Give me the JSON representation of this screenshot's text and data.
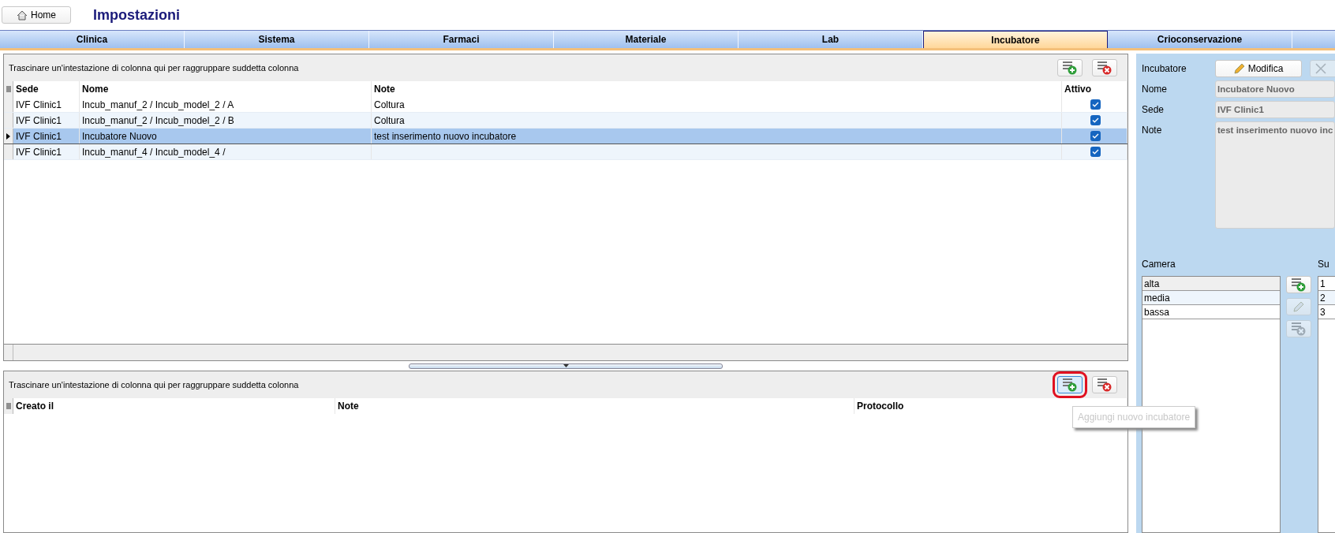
{
  "top_bar": {
    "home_button": "Home",
    "title": "Impostazioni"
  },
  "tabs": [
    {
      "label": "Clinica",
      "selected": false
    },
    {
      "label": "Sistema",
      "selected": false
    },
    {
      "label": "Farmaci",
      "selected": false
    },
    {
      "label": "Materiale",
      "selected": false
    },
    {
      "label": "Lab",
      "selected": false
    },
    {
      "label": "Incubatore",
      "selected": true
    },
    {
      "label": "Crioconservazione",
      "selected": false
    }
  ],
  "upper_grid": {
    "group_hint": "Trascinare un'intestazione di colonna qui per raggruppare suddetta colonna",
    "buttons": [
      {
        "kind": "add",
        "highlighted": false
      },
      {
        "kind": "delete",
        "highlighted": false
      }
    ],
    "columns": [
      "Sede",
      "Nome",
      "Note",
      "Attivo"
    ],
    "rows": [
      {
        "sede": "IVF Clinic1",
        "nome": "Incub_manuf_2 / Incub_model_2 / A",
        "note": "Coltura",
        "attivo": true,
        "selected": false
      },
      {
        "sede": "IVF Clinic1",
        "nome": "Incub_manuf_2 / Incub_model_2 / B",
        "note": "Coltura",
        "attivo": true,
        "selected": false
      },
      {
        "sede": "IVF Clinic1",
        "nome": "Incubatore Nuovo",
        "note": "test inserimento nuovo incubatore",
        "attivo": true,
        "selected": true
      },
      {
        "sede": "IVF Clinic1",
        "nome": "Incub_manuf_4 / Incub_model_4 /",
        "attivo": true,
        "selected": false
      }
    ]
  },
  "lower_grid": {
    "group_hint": "Trascinare un'intestazione di colonna qui per raggruppare suddetta colonna",
    "buttons": [
      {
        "kind": "add",
        "highlighted": true
      },
      {
        "kind": "delete",
        "highlighted": false
      }
    ],
    "columns": [
      "Creato il",
      "Note",
      "Protocollo"
    ],
    "tooltip": "Aggiungi nuovo incubatore"
  },
  "detail": {
    "label": "Incubatore",
    "edit_button": "Modifica",
    "cancel_button": {
      "disabled": true
    },
    "fields": [
      {
        "label": "Nome",
        "value": "Incubatore Nuovo",
        "kind": "line"
      },
      {
        "label": "Sede",
        "value": "IVF Clinic1",
        "kind": "line"
      },
      {
        "label": "Note",
        "value": "test inserimento nuovo inc",
        "kind": "multiline"
      }
    ],
    "camera": {
      "label": "Camera",
      "items": [
        {
          "name": "alta",
          "selected": true
        },
        {
          "name": "media",
          "selected": false
        },
        {
          "name": "bassa",
          "selected": false
        }
      ],
      "buttons": [
        {
          "kind": "add",
          "disabled": false
        },
        {
          "kind": "edit",
          "disabled": true
        },
        {
          "kind": "delete",
          "disabled": true
        }
      ]
    },
    "column_2": {
      "label": "Su",
      "items": [
        "1",
        "2",
        "3"
      ]
    }
  }
}
